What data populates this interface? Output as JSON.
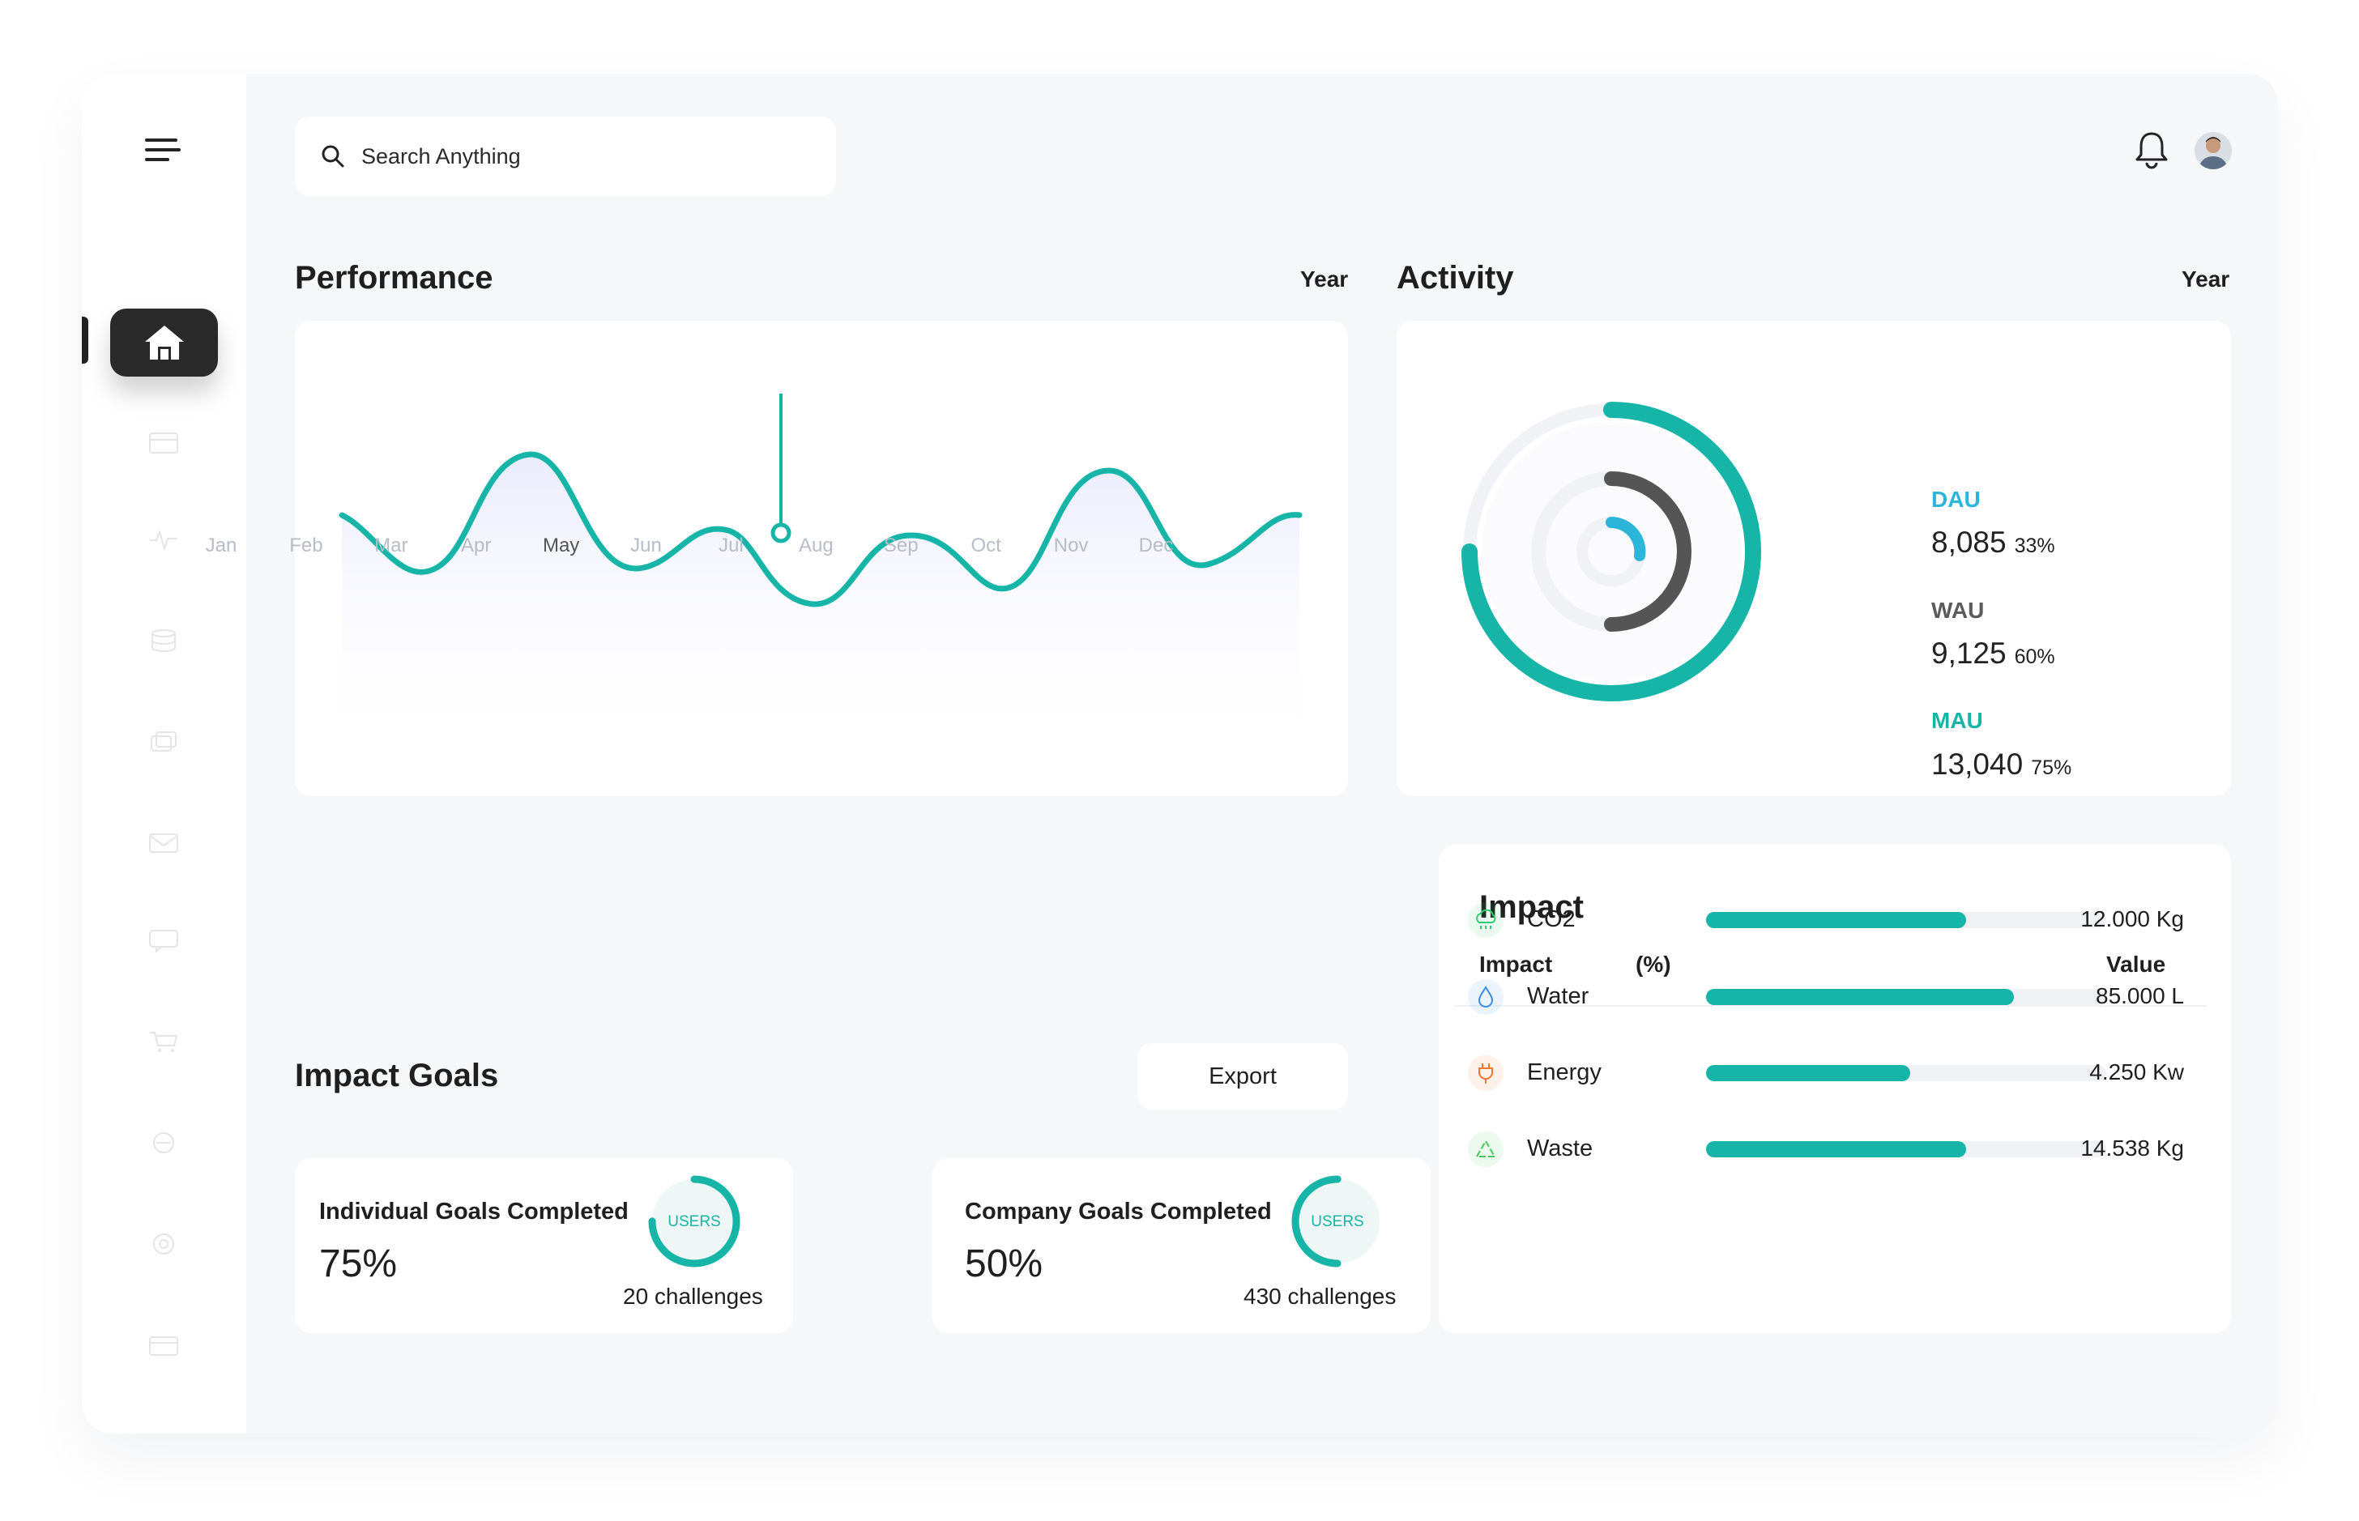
{
  "search": {
    "placeholder": "Search Anything"
  },
  "performance": {
    "title": "Performance",
    "period": "Year",
    "months": [
      "Jan",
      "Feb",
      "Mar",
      "Apr",
      "May",
      "Jun",
      "Jul",
      "Aug",
      "Sep",
      "Oct",
      "Nov",
      "Dec"
    ],
    "active_month": "May"
  },
  "activity": {
    "title": "Activity",
    "period": "Year",
    "stats": [
      {
        "label": "DAU",
        "value": "8,085",
        "pct": "33%",
        "color": "#2bb6d9"
      },
      {
        "label": "WAU",
        "value": "9,125",
        "pct": "60%",
        "color": "#5b5b5b"
      },
      {
        "label": "MAU",
        "value": "13,040",
        "pct": "75%",
        "color": "#16b5a8"
      }
    ]
  },
  "impact": {
    "title": "Impact",
    "headers": {
      "name": "Impact",
      "pct": "(%)",
      "value": "Value"
    },
    "rows": [
      {
        "name": "CO2",
        "value": "12.000 Kg",
        "fill": 0.65,
        "icon": "cloud-icon",
        "icon_color": "#2ecc71"
      },
      {
        "name": "Water",
        "value": "85.000 L",
        "fill": 0.77,
        "icon": "water-drop-icon",
        "icon_color": "#3b8fe0"
      },
      {
        "name": "Energy",
        "value": "4.250 Kw",
        "fill": 0.51,
        "icon": "plug-icon",
        "icon_color": "#f2762e"
      },
      {
        "name": "Waste",
        "value": "14.538 Kg",
        "fill": 0.65,
        "icon": "recycle-icon",
        "icon_color": "#46c85a"
      }
    ]
  },
  "goals": {
    "title": "Impact Goals",
    "export_label": "Export",
    "individual": {
      "title": "Individual Goals Completed",
      "value": "75%",
      "badge": "USERS",
      "sub": "20 challenges",
      "progress": 0.75
    },
    "company": {
      "title": "Company Goals Completed",
      "value": "50%",
      "badge": "USERS",
      "sub": "430 challenges",
      "progress": 0.5
    }
  },
  "colors": {
    "accent": "#16b5a8",
    "dark": "#2a2a2a",
    "cyan": "#2bb6d9"
  }
}
